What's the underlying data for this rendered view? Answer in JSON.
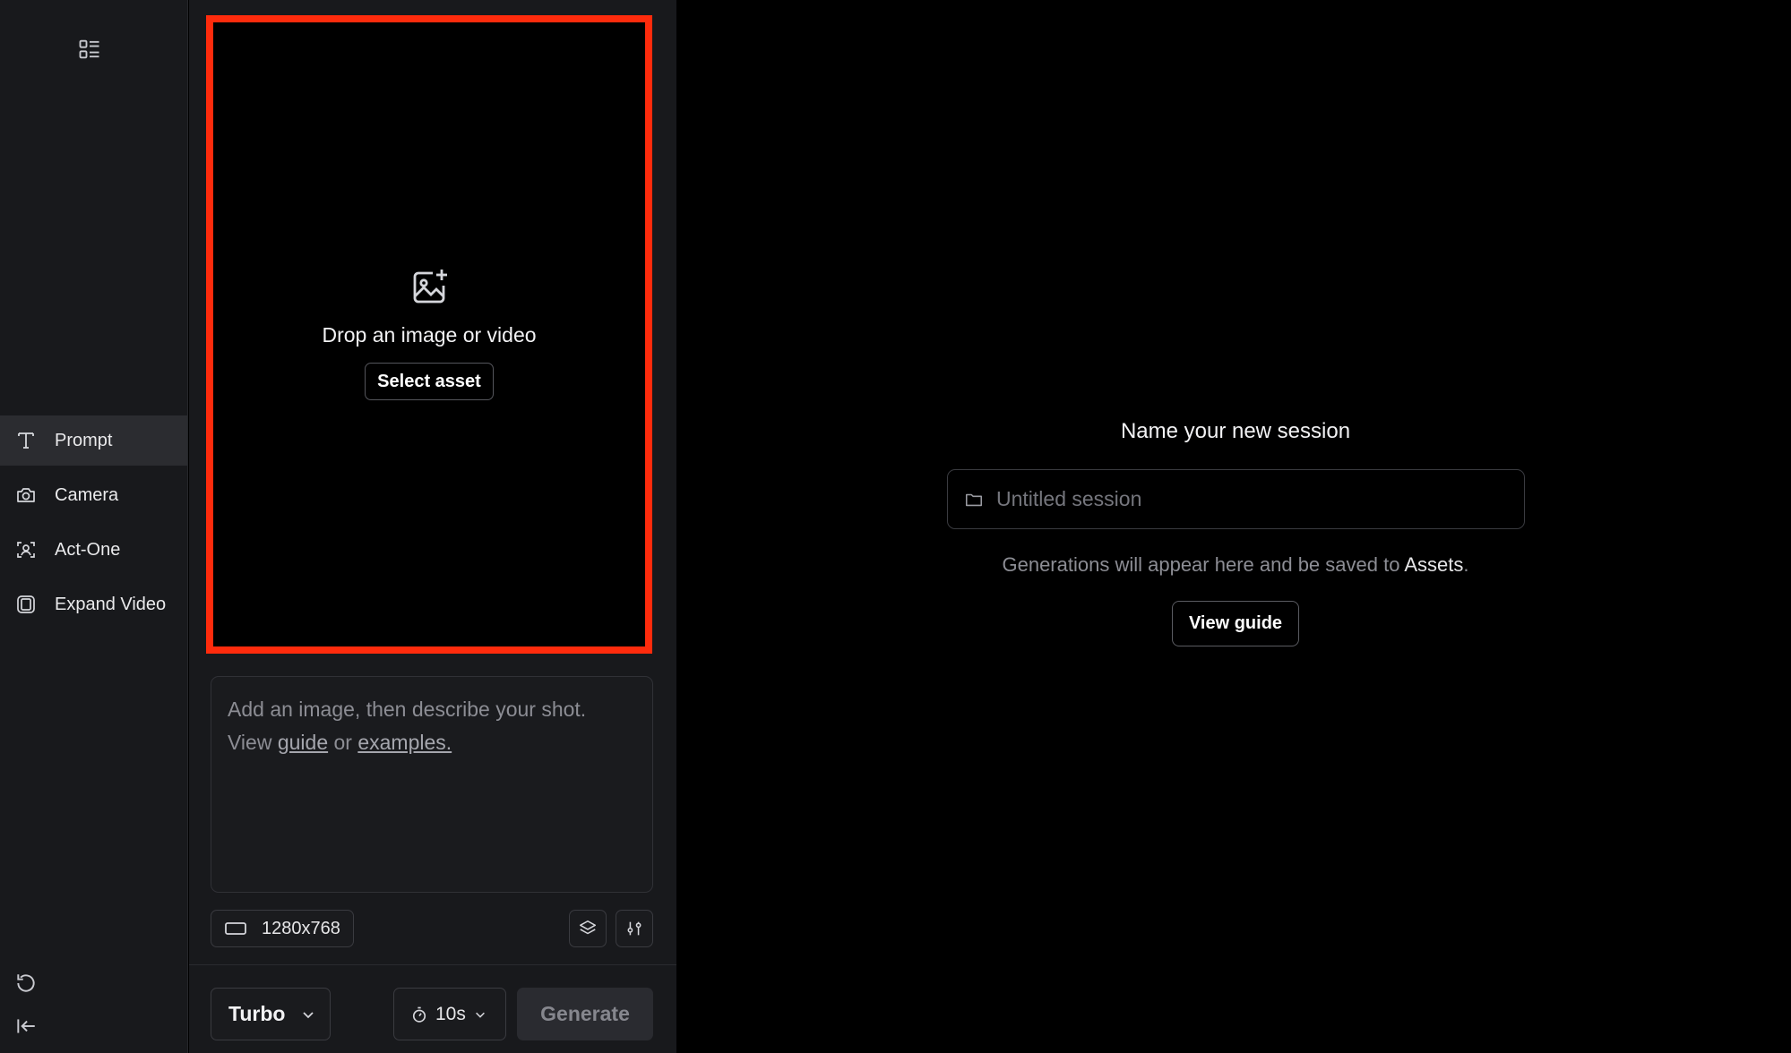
{
  "sidebar": {
    "top_icon": "layout-list-icon",
    "items": [
      {
        "label": "Prompt",
        "icon": "text-t-icon",
        "active": true
      },
      {
        "label": "Camera",
        "icon": "camera-icon",
        "active": false
      },
      {
        "label": "Act-One",
        "icon": "face-scan-icon",
        "active": false
      },
      {
        "label": "Expand Video",
        "icon": "expand-frame-icon",
        "active": false
      }
    ],
    "bottom_icons": [
      "undo-icon",
      "collapse-sidebar-icon"
    ]
  },
  "panel": {
    "dropzone": {
      "text": "Drop an image or video",
      "button_label": "Select asset",
      "border_color": "#fe2b0c"
    },
    "prompt": {
      "line1": "Add an image, then describe your shot.",
      "line2_prefix": "View",
      "guide_link": "guide",
      "or_word": "or",
      "examples_link": "examples."
    },
    "resolution": "1280x768",
    "model": "Turbo",
    "duration": "10s",
    "generate_label": "Generate"
  },
  "main": {
    "session_title": "Name your new session",
    "session_placeholder": "Untitled session",
    "note_prefix": "Generations will appear here and be saved to",
    "note_link": "Assets",
    "note_suffix": ".",
    "guide_button": "View guide"
  }
}
